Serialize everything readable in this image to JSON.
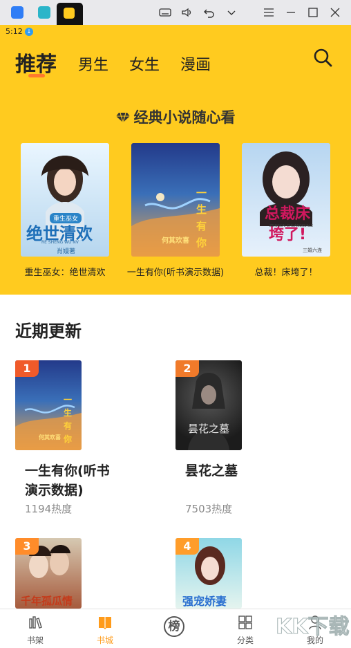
{
  "status": {
    "time": "5:12"
  },
  "nav": {
    "tabs": [
      "推荐",
      "男生",
      "女生",
      "漫画"
    ]
  },
  "featured": {
    "title": "经典小说随心看",
    "books": [
      {
        "title": "重生巫女：绝世清欢",
        "cover_text": "绝世清欢",
        "cover_tag": "重生巫女",
        "cover_sub": "RE SHENG WU NV",
        "cover_author": "肖嫚著",
        "colors": [
          "#eaf6ff",
          "#7aa9d9"
        ]
      },
      {
        "title": "一生有你(听书演示数据)",
        "cover_text": "一生有你",
        "cover_author": "何其欢喜",
        "colors": [
          "#2a3f8f",
          "#f0a64a"
        ]
      },
      {
        "title": "总裁！床垮了！",
        "cover_text": "总裁床垮了!",
        "cover_sub": "ZONGCAI CHUANGKUALE",
        "cover_author": "三婚六连",
        "colors": [
          "#b7d6f1",
          "#e7f1fb"
        ]
      }
    ]
  },
  "recent": {
    "title": "近期更新",
    "books": [
      {
        "rank": "1",
        "name_lines": [
          "一生有你(听书",
          "演示数据)"
        ],
        "heat": "1194热度",
        "cover_text": "一生有你",
        "cover_author": "何其欢喜",
        "rank_color": "#f05a2a",
        "colors": [
          "#2a3f8f",
          "#f0a64a"
        ]
      },
      {
        "rank": "2",
        "name_lines": [
          "昙花之墓"
        ],
        "heat": "7503热度",
        "cover_text": "昙花之墓",
        "rank_color": "#f07a2a",
        "colors": [
          "#3b3b3b",
          "#1c1c1c"
        ]
      },
      {
        "rank": "3",
        "cover_text": "千年孤瓜情",
        "rank_color": "#ff8c2a",
        "colors": [
          "#d6c9b2",
          "#a65a3c"
        ]
      },
      {
        "rank": "4",
        "cover_text": "强宠娇妻",
        "rank_color": "#ff9d2a",
        "colors": [
          "#8fd7e6",
          "#e5f4ef"
        ]
      }
    ]
  },
  "bottom_nav": [
    {
      "label": "书架",
      "icon": "bookshelf-icon"
    },
    {
      "label": "书城",
      "icon": "bookstore-icon",
      "active": true
    },
    {
      "label": "",
      "icon": "ranking-icon",
      "text": "榜"
    },
    {
      "label": "分类",
      "icon": "category-icon"
    },
    {
      "label": "我的",
      "icon": "profile-icon"
    }
  ],
  "colors": {
    "brand_yellow": "#ffcb1f",
    "accent_orange": "#ff9b1a",
    "underline": "#ff7a2d"
  },
  "watermark": {
    "text": "KK下载"
  }
}
